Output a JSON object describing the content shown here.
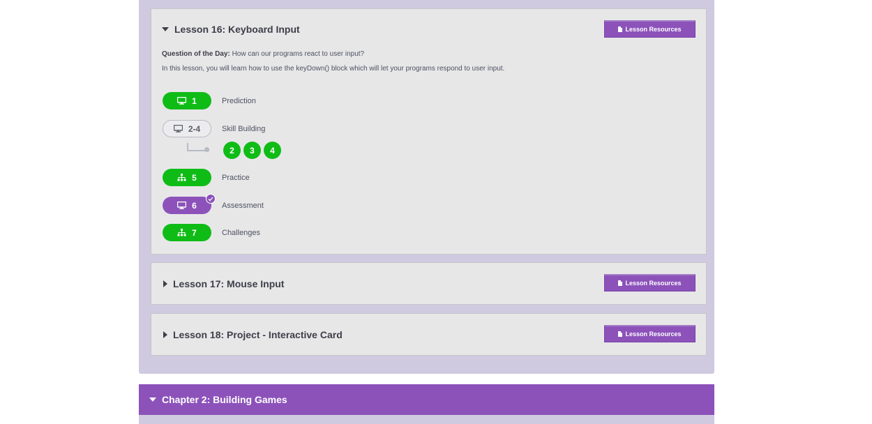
{
  "lessons": {
    "l16": {
      "title": "Lesson 16: Keyboard Input",
      "resources_label": "Lesson Resources",
      "qotd_label": "Question of the Day:",
      "qotd_text": " How can our programs react to user input?",
      "description": "In this lesson, you will learn how to use the keyDown() block which will let your programs respond to user input.",
      "levels": [
        {
          "number": "1",
          "name": "Prediction",
          "icon": "computer-icon",
          "status": "completed"
        },
        {
          "number": "2-4",
          "name": "Skill Building",
          "icon": "computer-icon",
          "status": "group"
        },
        {
          "number": "5",
          "name": "Practice",
          "icon": "hierarchy-icon",
          "status": "completed"
        },
        {
          "number": "6",
          "name": "Assessment",
          "icon": "computer-icon",
          "status": "assessment-submitted"
        },
        {
          "number": "7",
          "name": "Challenges",
          "icon": "hierarchy-icon",
          "status": "completed"
        }
      ],
      "sublevels": [
        "2",
        "3",
        "4"
      ]
    },
    "l17": {
      "title": "Lesson 17: Mouse Input",
      "resources_label": "Lesson Resources"
    },
    "l18": {
      "title": "Lesson 18: Project - Interactive Card",
      "resources_label": "Lesson Resources"
    }
  },
  "chapter2": {
    "title": "Chapter 2: Building Games"
  },
  "colors": {
    "completed": "#0fbc16",
    "assessment": "#8c52ba",
    "chapter_bg": "#cfcadf",
    "card_bg": "#e7e7e8"
  }
}
